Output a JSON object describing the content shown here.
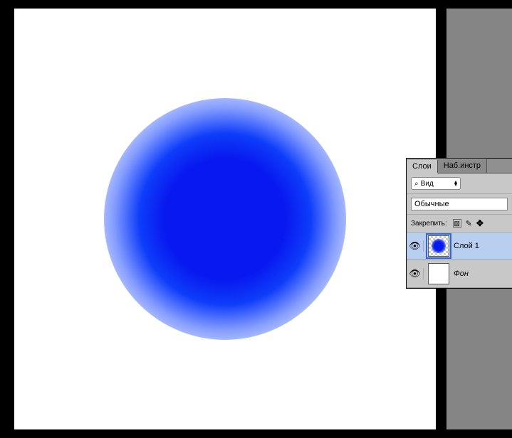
{
  "panel": {
    "tabs": {
      "layers": "Слои",
      "presets": "Наб.инстр"
    },
    "search": {
      "label": "Вид"
    },
    "blend_mode": "Обычные",
    "lock_label": "Закрепить:"
  },
  "layers": [
    {
      "name": "Слой 1",
      "selected": true,
      "visible": true,
      "type": "circle"
    },
    {
      "name": "Фон",
      "selected": false,
      "visible": true,
      "type": "white",
      "italic": true
    }
  ]
}
